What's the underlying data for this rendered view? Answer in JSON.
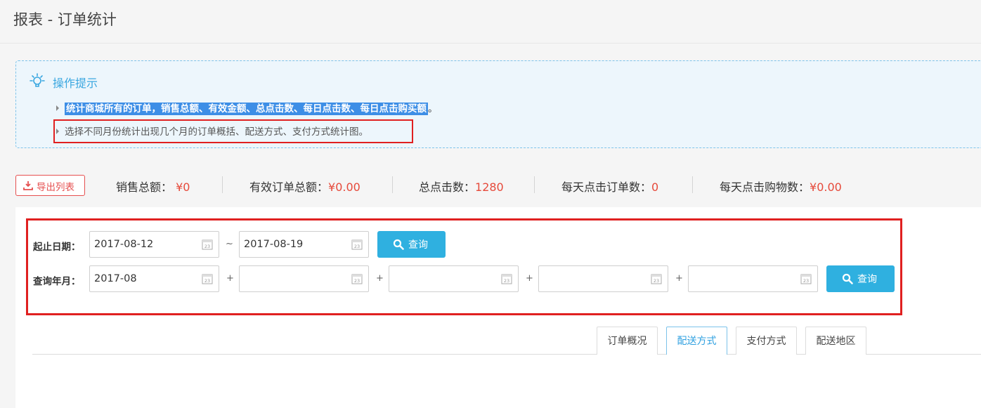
{
  "page": {
    "title": "报表 - 订单统计"
  },
  "tips": {
    "title": "操作提示",
    "line1": "统计商城所有的订单，销售总额、有效金额、总点击数、每日点击数、每日点击购买额",
    "line1_end": "。",
    "line2": "选择不同月份统计出现几个月的订单概括、配送方式、支付方式统计图。"
  },
  "stats": {
    "export_label": "导出列表",
    "items": [
      {
        "label": "销售总额：",
        "value": "¥0"
      },
      {
        "label": "有效订单总额：",
        "value": "¥0.00"
      },
      {
        "label": "总点击数：",
        "value": "1280"
      },
      {
        "label": "每天点击订单数：",
        "value": "0"
      },
      {
        "label": "每天点击购物数：",
        "value": "¥0.00"
      }
    ]
  },
  "query": {
    "range_label": "起止日期：",
    "range_start": "2017-08-12",
    "range_sep": "~",
    "range_end": "2017-08-19",
    "month_label": "查询年月：",
    "months": [
      "2017-08",
      "",
      "",
      "",
      ""
    ],
    "plus": "+",
    "button_label": "查询",
    "calendar_day": "23"
  },
  "tabs": [
    {
      "label": "订单概况",
      "active": false
    },
    {
      "label": "配送方式",
      "active": true
    },
    {
      "label": "支付方式",
      "active": false
    },
    {
      "label": "配送地区",
      "active": false
    }
  ],
  "colors": {
    "accent": "#2fb0e0",
    "value_red": "#e64a3b",
    "highlight_box": "#e02020"
  }
}
